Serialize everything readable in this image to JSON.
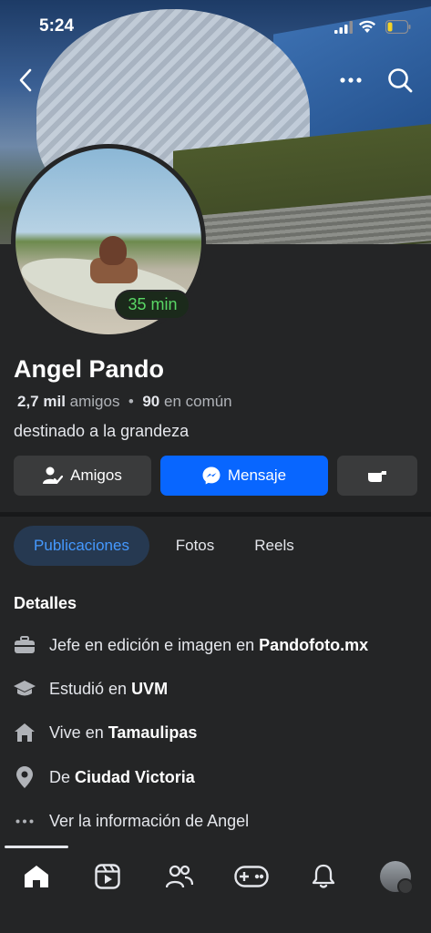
{
  "status_bar": {
    "time": "5:24"
  },
  "profile": {
    "name": "Angel Pando",
    "friends_count": "2,7 mil",
    "friends_label": "amigos",
    "separator": "•",
    "mutual_count": "90",
    "mutual_label": "en común",
    "bio": "destinado a la grandeza",
    "active_badge": "35 min"
  },
  "actions": {
    "friends_label": "Amigos",
    "message_label": "Mensaje"
  },
  "tabs": [
    {
      "label": "Publicaciones",
      "active": true
    },
    {
      "label": "Fotos",
      "active": false
    },
    {
      "label": "Reels",
      "active": false
    }
  ],
  "details": {
    "title": "Detalles",
    "rows": [
      {
        "icon": "briefcase-icon",
        "prefix": "Jefe en edición e imagen en",
        "value": "Pandofoto.mx"
      },
      {
        "icon": "graduation-cap-icon",
        "prefix": "Estudió en",
        "value": "UVM"
      },
      {
        "icon": "home-icon",
        "prefix": "Vive en",
        "value": "Tamaulipas"
      },
      {
        "icon": "location-pin-icon",
        "prefix": "De",
        "value": "Ciudad Victoria"
      },
      {
        "icon": "more-dots-icon",
        "prefix": "Ver la información de Angel",
        "value": ""
      }
    ]
  },
  "colors": {
    "background": "#242526",
    "primary_button": "#0866ff",
    "active_tab_bg": "#263951",
    "active_tab_text": "#4599ff",
    "badge_text": "#59d665"
  },
  "bottom_nav": [
    {
      "icon": "home-icon",
      "active": true
    },
    {
      "icon": "reels-icon",
      "active": false
    },
    {
      "icon": "friends-icon",
      "active": false
    },
    {
      "icon": "gaming-icon",
      "active": false
    },
    {
      "icon": "bell-icon",
      "active": false
    },
    {
      "icon": "profile-avatar-icon",
      "active": false
    }
  ]
}
